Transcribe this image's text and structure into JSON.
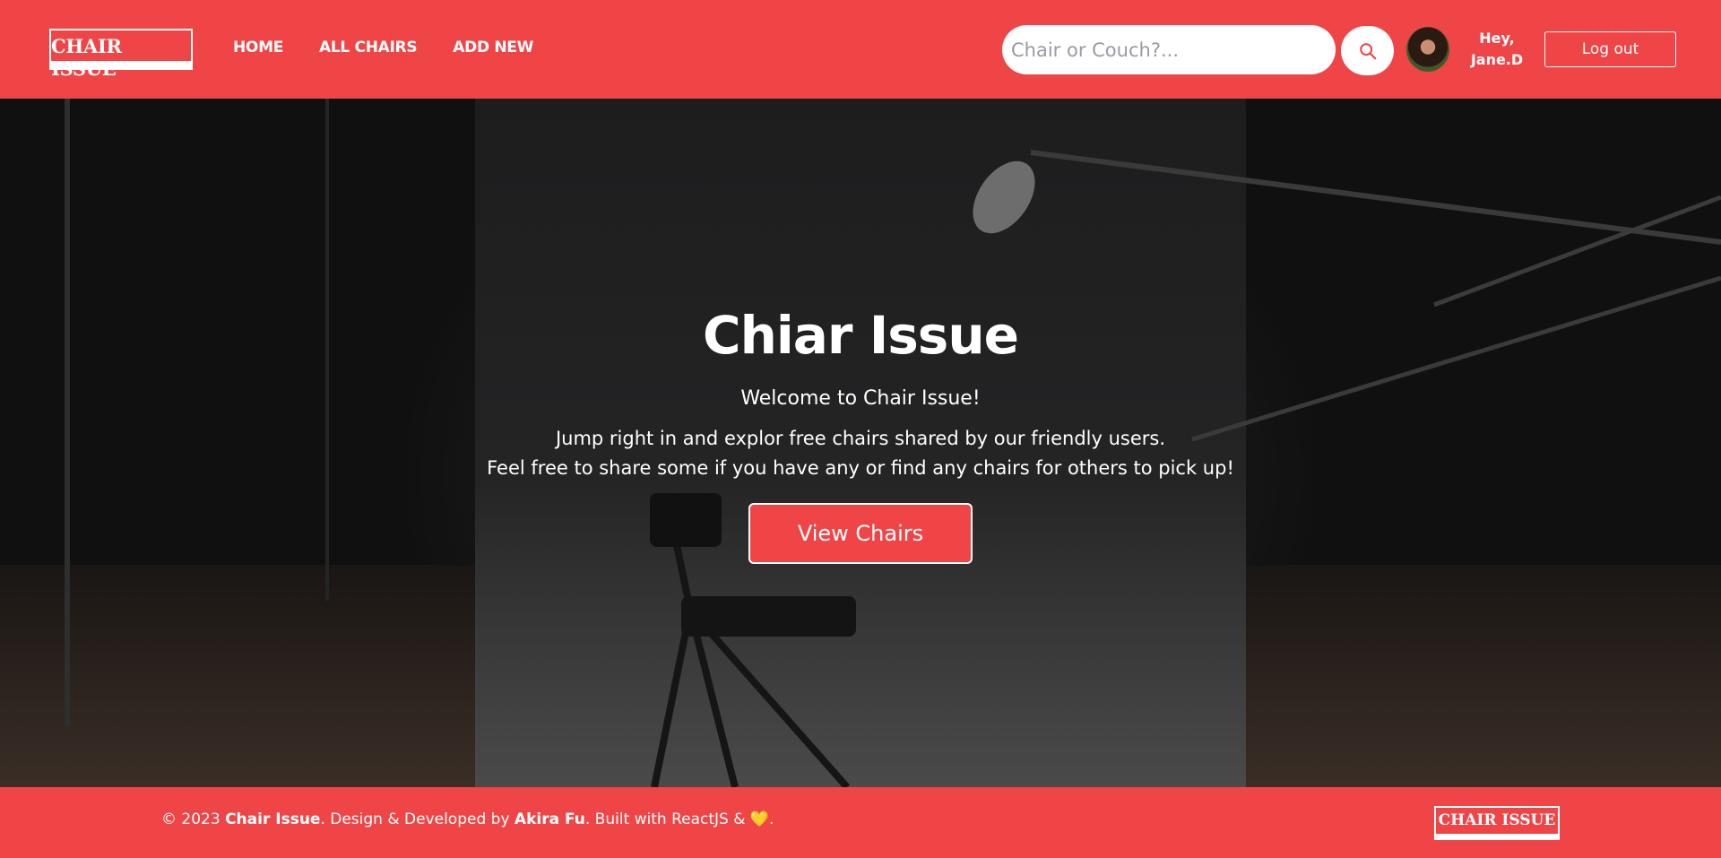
{
  "header": {
    "logo": "CHAIR ISSUE",
    "nav": [
      {
        "label": "HOME"
      },
      {
        "label": "ALL CHAIRS"
      },
      {
        "label": "ADD NEW"
      }
    ],
    "search": {
      "placeholder": "Chair or Couch?...",
      "value": ""
    },
    "search_icon": "search-icon",
    "greeting_line1": "Hey,",
    "greeting_line2": "Jane.D",
    "logout_label": "Log out"
  },
  "hero": {
    "title": "Chiar Issue",
    "welcome": "Welcome to Chair Issue!",
    "line1": "Jump right in and explor free chairs shared by our friendly users.",
    "line2": "Feel free to share some if you have any or find any chairs for others to pick up!",
    "cta_label": "View Chairs"
  },
  "footer": {
    "copyright": "© 2023",
    "brand": "Chair Issue",
    "developed_by": ". Design & Developed by",
    "author": "Akira Fu",
    "built_with": ". Built with ReactJS &",
    "heart": "💛",
    "end": ".",
    "logo": "CHAIR ISSUE"
  },
  "colors": {
    "brand": "#ef4547",
    "text_light": "#ffffff"
  }
}
